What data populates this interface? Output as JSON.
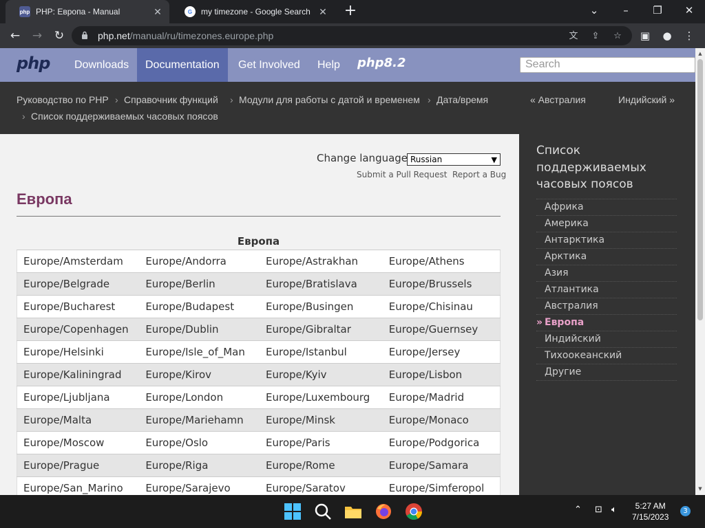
{
  "browser": {
    "tabs": [
      {
        "title": "PHP: Европа - Manual",
        "favicon": "php",
        "active": true
      },
      {
        "title": "my timezone - Google Search",
        "favicon": "G",
        "active": false
      }
    ],
    "url_domain": "php.net",
    "url_path": "/manual/ru/timezones.europe.php"
  },
  "php_nav": {
    "logo": "php",
    "links": [
      "Downloads",
      "Documentation",
      "Get Involved",
      "Help"
    ],
    "active_link": "Documentation",
    "version_badge": "php8.2",
    "search_placeholder": "Search"
  },
  "breadcrumbs": {
    "items": [
      "Руководство по PHP",
      "Справочник функций",
      "Модули для работы с датой и временем",
      "Дата/время",
      "Список поддерживаемых часовых поясов"
    ],
    "prev_link": "« Австралия",
    "next_link": "Индийский »"
  },
  "content": {
    "change_language_label": "Change language:",
    "language_selected": "Russian",
    "submit_pr": "Submit a Pull Request",
    "report_bug": "Report a Bug",
    "title": "Европа",
    "table_caption": "Европа",
    "rows": [
      [
        "Europe/Amsterdam",
        "Europe/Andorra",
        "Europe/Astrakhan",
        "Europe/Athens"
      ],
      [
        "Europe/Belgrade",
        "Europe/Berlin",
        "Europe/Bratislava",
        "Europe/Brussels"
      ],
      [
        "Europe/Bucharest",
        "Europe/Budapest",
        "Europe/Busingen",
        "Europe/Chisinau"
      ],
      [
        "Europe/Copenhagen",
        "Europe/Dublin",
        "Europe/Gibraltar",
        "Europe/Guernsey"
      ],
      [
        "Europe/Helsinki",
        "Europe/Isle_of_Man",
        "Europe/Istanbul",
        "Europe/Jersey"
      ],
      [
        "Europe/Kaliningrad",
        "Europe/Kirov",
        "Europe/Kyiv",
        "Europe/Lisbon"
      ],
      [
        "Europe/Ljubljana",
        "Europe/London",
        "Europe/Luxembourg",
        "Europe/Madrid"
      ],
      [
        "Europe/Malta",
        "Europe/Mariehamn",
        "Europe/Minsk",
        "Europe/Monaco"
      ],
      [
        "Europe/Moscow",
        "Europe/Oslo",
        "Europe/Paris",
        "Europe/Podgorica"
      ],
      [
        "Europe/Prague",
        "Europe/Riga",
        "Europe/Rome",
        "Europe/Samara"
      ],
      [
        "Europe/San_Marino",
        "Europe/Sarajevo",
        "Europe/Saratov",
        "Europe/Simferopol"
      ]
    ]
  },
  "sidebar": {
    "title": "Список поддерживаемых часовых поясов",
    "items": [
      "Африка",
      "Америка",
      "Антарктика",
      "Арктика",
      "Азия",
      "Атлантика",
      "Австралия",
      "Европа",
      "Индийский",
      "Тихоокеанский",
      "Другие"
    ],
    "current": "Европа"
  },
  "taskbar": {
    "apps": [
      "windows-start",
      "search",
      "file-explorer",
      "firefox",
      "chrome"
    ],
    "time": "5:27 AM",
    "date": "7/15/2023",
    "notification_count": "3"
  },
  "colors": {
    "php_nav": "#8892bf",
    "php_nav_active": "#5a6aaa",
    "title_color": "#793862",
    "sidebar_current": "#e8a0c8"
  }
}
